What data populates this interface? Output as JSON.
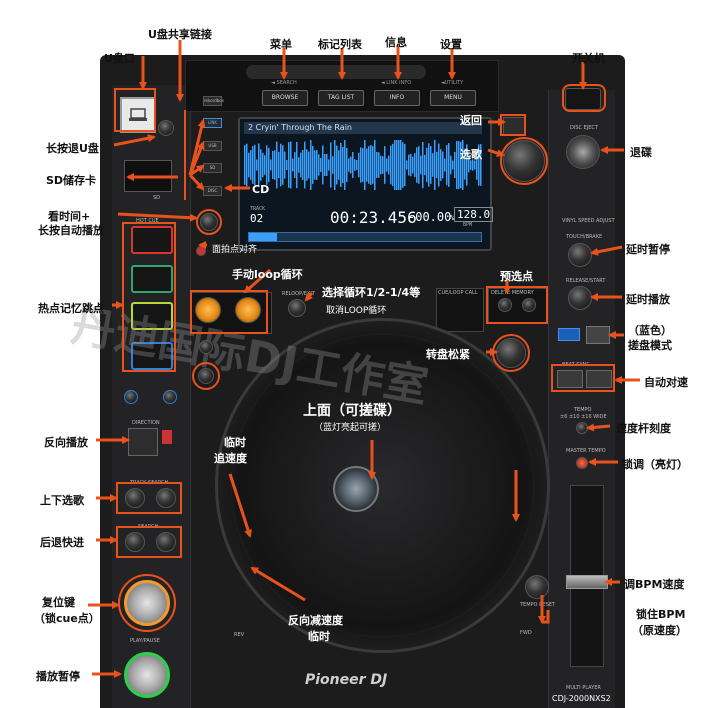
{
  "annotations": {
    "u_port": "U盘口",
    "u_share": "U盘共享链接",
    "menu": "菜单",
    "tag_list": "标记列表",
    "info": "信息",
    "settings": "设置",
    "power": "开关机",
    "long_press_eject_u": "长按退U盘",
    "back": "返回",
    "select": "选歌",
    "eject": "退碟",
    "sd_card": "SD储存卡",
    "cd": "CD",
    "time_mode": "看时间+",
    "auto_cue": "长按自动播放",
    "beat_sync": "面拍点对齐",
    "manual_loop": "手动loop循环",
    "loop_select": "选择循环1/2-1/4等",
    "loop_cancel": "取消LOOP循环",
    "preset_point": "预选点",
    "delay_stop": "延时暂停",
    "delay_start": "延时播放",
    "vinyl_mode_line1": "（蓝色）",
    "vinyl_mode_line2": "搓盘模式",
    "hot_cue": "热点记忆跳点",
    "platter_tension": "转盘松紧",
    "auto_sync": "自动对速",
    "top_surface_line1": "上面（可搓碟）",
    "top_surface_line2": "（蓝灯亮起可搓）",
    "temp_speed_line1": "临时",
    "temp_speed_line2": "追速度",
    "tempo_range": "速度杆刻度",
    "reverse": "反向播放",
    "key_lock": "锁调（亮灯）",
    "track_search": "上下选歌",
    "search": "后退快进",
    "adjust_bpm": "调BPM速度",
    "reset_line1": "复位键",
    "reset_line2": "（锁cue点）",
    "lock_bpm_line1": "锁住BPM",
    "lock_bpm_line2": "（原速度）",
    "reverse_slow_line1": "反向减速度",
    "reverse_slow_line2": "临时",
    "play_pause": "播放暂停"
  },
  "device": {
    "brand": "Pioneer DJ",
    "model": "CDJ-2000NXS2",
    "model_sub": "MULTI PLAYER",
    "watermark": "丹迪国际DJ工作室"
  },
  "top_buttons": [
    {
      "top": "◄ SEARCH",
      "label": "BROWSE"
    },
    {
      "top": "",
      "label": "TAG LIST"
    },
    {
      "top": "◄ LINK INFO",
      "label": "INFO"
    },
    {
      "top": "◄UTILITY",
      "label": "MENU"
    }
  ],
  "source_buttons": [
    "rekordbox",
    "LINK",
    "SD",
    "USB",
    "DISC"
  ],
  "screen": {
    "track_title": "2 Cryin' Through The Rain",
    "track_label": "TRACK",
    "track_number": "02",
    "time": "00:23.456",
    "tempo": "-00.00",
    "tempo_unit": "%",
    "bpm": "128.0",
    "bpm_label": "BPM"
  },
  "panel_labels": {
    "hot_cue": "HOT CUE",
    "call_memory": "DELETE  MEMORY",
    "cue_loop": "CUE/LOOP CALL",
    "reloop": "RELOOP/EXIT",
    "vinyl_speed": "VINYL SPEED ADJUST",
    "touch_brake": "TOUCH/BRAKE",
    "release_start": "RELEASE/START",
    "beat_sync": "BEAT SYNC",
    "tempo": "TEMPO",
    "tempo_range": "±6 ±10 ±16 WIDE",
    "master_tempo": "MASTER TEMPO",
    "tempo_reset": "TEMPO RESET",
    "direction": "DIRECTION",
    "track_search": "TRACK SEARCH",
    "search": "SEARCH",
    "play_pause": "PLAY/PAUSE",
    "rev": "REV",
    "fwd": "FWD",
    "sd": "SD",
    "disc_eject": "DISC EJECT"
  },
  "colors": {
    "accent": "#e8521c",
    "hot_cue_a": "#d9362b",
    "hot_cue_b": "#2ea86a",
    "hot_cue_c": "#b7d83a",
    "hot_cue_d": "#2f7fd8",
    "play": "#2bd14a",
    "cue": "#f29a2e",
    "waveform": "#3aa0ff"
  },
  "icons": [
    "arrow-icon",
    "usb-icon",
    "power-icon",
    "eject-icon"
  ]
}
